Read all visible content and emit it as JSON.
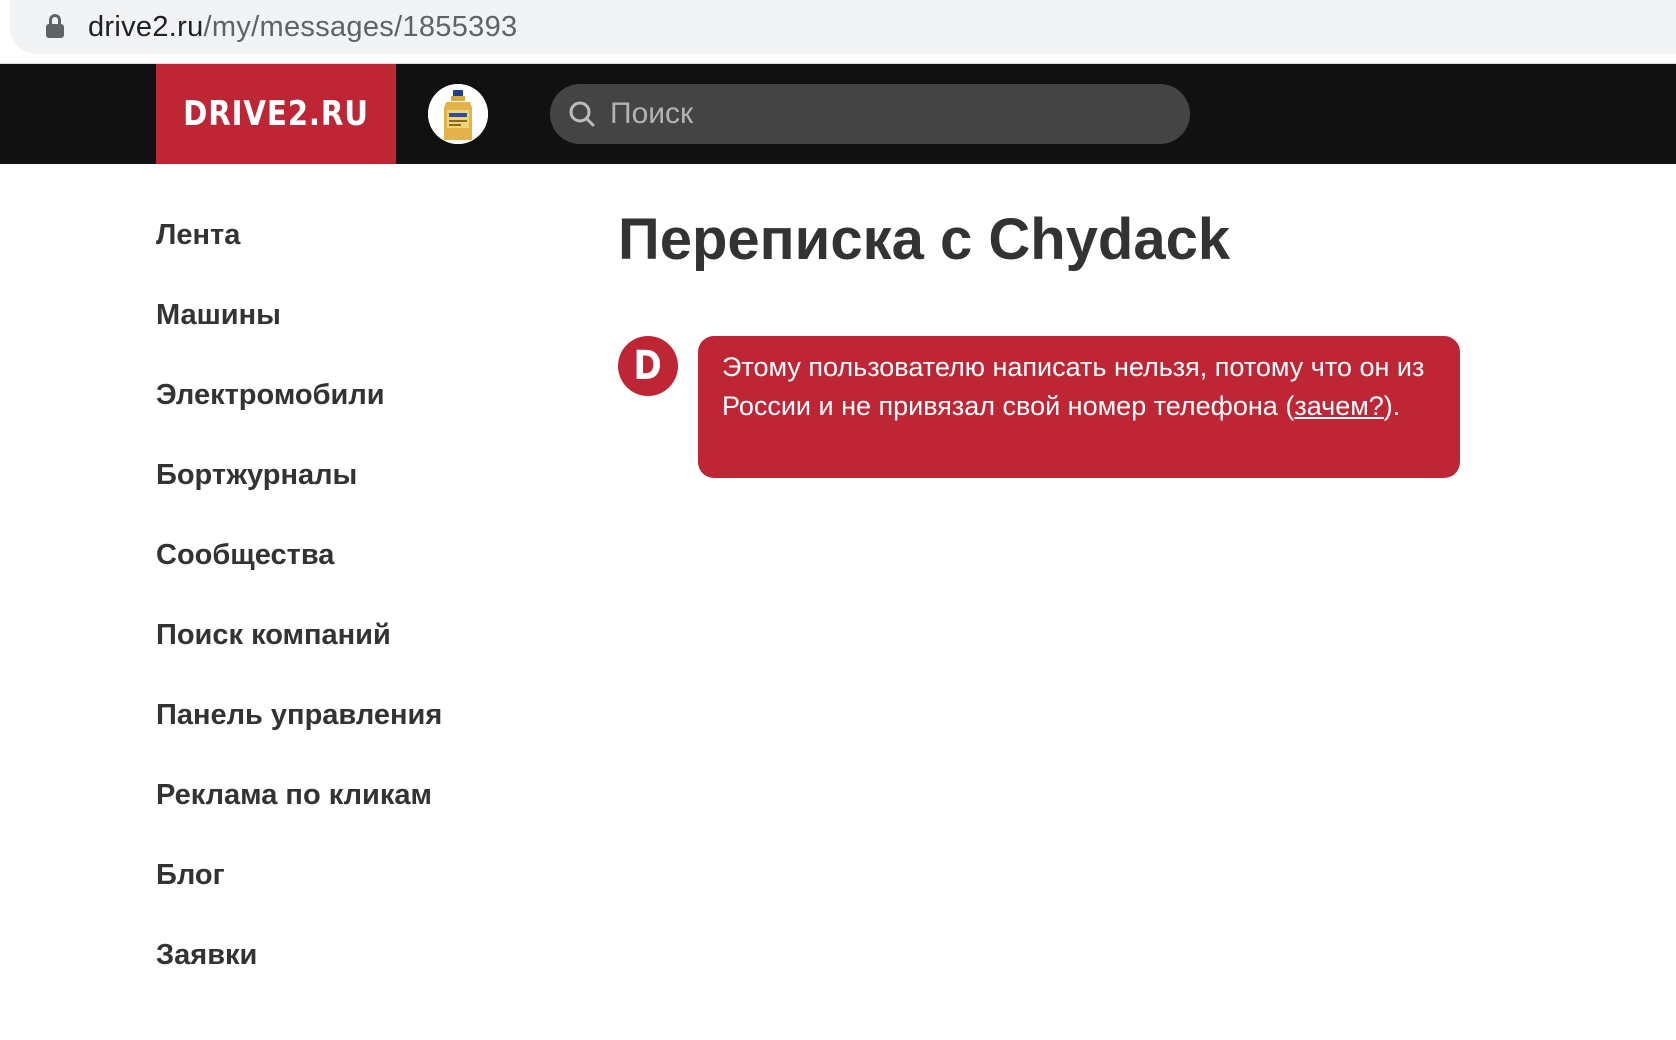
{
  "browser": {
    "url_host": "drive2.ru",
    "url_path": "/my/messages/1855393"
  },
  "header": {
    "logo_text": "DRIVE2.RU",
    "search_placeholder": "Поиск"
  },
  "sidebar": {
    "items": [
      {
        "label": "Лента"
      },
      {
        "label": "Машины"
      },
      {
        "label": "Электромобили"
      },
      {
        "label": "Бортжурналы"
      },
      {
        "label": "Сообщества"
      },
      {
        "label": "Поиск компаний"
      },
      {
        "label": "Панель управления"
      },
      {
        "label": "Реклама по кликам"
      },
      {
        "label": "Блог"
      },
      {
        "label": "Заявки"
      }
    ]
  },
  "main": {
    "title": "Переписка с Chydack",
    "message": {
      "sender_initial": "D",
      "text_before": "Этому пользователю написать нельзя, потому что он из России и не привязал свой номер телефона (",
      "link_text": "зачем?",
      "text_after": ")."
    }
  },
  "colors": {
    "brand_red": "#be2636",
    "header_bg": "#111111",
    "text_dark": "#333333"
  }
}
